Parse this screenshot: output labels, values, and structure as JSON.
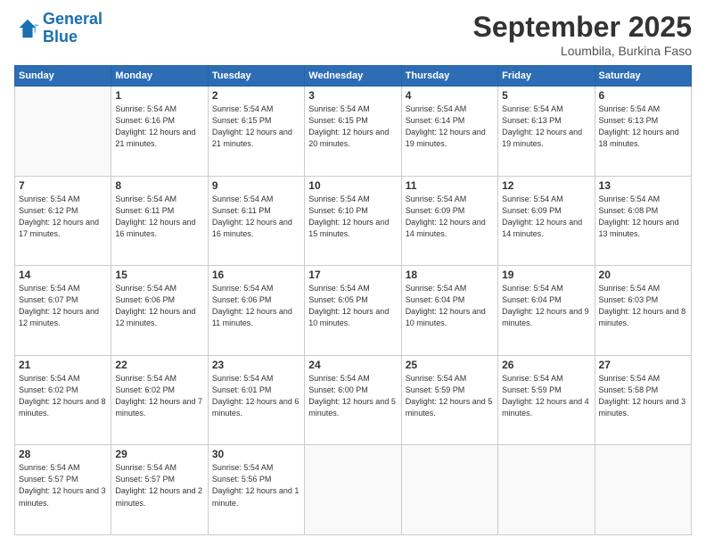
{
  "header": {
    "logo_line1": "General",
    "logo_line2": "Blue",
    "title": "September 2025",
    "location": "Loumbila, Burkina Faso"
  },
  "weekdays": [
    "Sunday",
    "Monday",
    "Tuesday",
    "Wednesday",
    "Thursday",
    "Friday",
    "Saturday"
  ],
  "weeks": [
    [
      {
        "day": "",
        "sunrise": "",
        "sunset": "",
        "daylight": ""
      },
      {
        "day": "1",
        "sunrise": "Sunrise: 5:54 AM",
        "sunset": "Sunset: 6:16 PM",
        "daylight": "Daylight: 12 hours and 21 minutes."
      },
      {
        "day": "2",
        "sunrise": "Sunrise: 5:54 AM",
        "sunset": "Sunset: 6:15 PM",
        "daylight": "Daylight: 12 hours and 21 minutes."
      },
      {
        "day": "3",
        "sunrise": "Sunrise: 5:54 AM",
        "sunset": "Sunset: 6:15 PM",
        "daylight": "Daylight: 12 hours and 20 minutes."
      },
      {
        "day": "4",
        "sunrise": "Sunrise: 5:54 AM",
        "sunset": "Sunset: 6:14 PM",
        "daylight": "Daylight: 12 hours and 19 minutes."
      },
      {
        "day": "5",
        "sunrise": "Sunrise: 5:54 AM",
        "sunset": "Sunset: 6:13 PM",
        "daylight": "Daylight: 12 hours and 19 minutes."
      },
      {
        "day": "6",
        "sunrise": "Sunrise: 5:54 AM",
        "sunset": "Sunset: 6:13 PM",
        "daylight": "Daylight: 12 hours and 18 minutes."
      }
    ],
    [
      {
        "day": "7",
        "sunrise": "Sunrise: 5:54 AM",
        "sunset": "Sunset: 6:12 PM",
        "daylight": "Daylight: 12 hours and 17 minutes."
      },
      {
        "day": "8",
        "sunrise": "Sunrise: 5:54 AM",
        "sunset": "Sunset: 6:11 PM",
        "daylight": "Daylight: 12 hours and 16 minutes."
      },
      {
        "day": "9",
        "sunrise": "Sunrise: 5:54 AM",
        "sunset": "Sunset: 6:11 PM",
        "daylight": "Daylight: 12 hours and 16 minutes."
      },
      {
        "day": "10",
        "sunrise": "Sunrise: 5:54 AM",
        "sunset": "Sunset: 6:10 PM",
        "daylight": "Daylight: 12 hours and 15 minutes."
      },
      {
        "day": "11",
        "sunrise": "Sunrise: 5:54 AM",
        "sunset": "Sunset: 6:09 PM",
        "daylight": "Daylight: 12 hours and 14 minutes."
      },
      {
        "day": "12",
        "sunrise": "Sunrise: 5:54 AM",
        "sunset": "Sunset: 6:09 PM",
        "daylight": "Daylight: 12 hours and 14 minutes."
      },
      {
        "day": "13",
        "sunrise": "Sunrise: 5:54 AM",
        "sunset": "Sunset: 6:08 PM",
        "daylight": "Daylight: 12 hours and 13 minutes."
      }
    ],
    [
      {
        "day": "14",
        "sunrise": "Sunrise: 5:54 AM",
        "sunset": "Sunset: 6:07 PM",
        "daylight": "Daylight: 12 hours and 12 minutes."
      },
      {
        "day": "15",
        "sunrise": "Sunrise: 5:54 AM",
        "sunset": "Sunset: 6:06 PM",
        "daylight": "Daylight: 12 hours and 12 minutes."
      },
      {
        "day": "16",
        "sunrise": "Sunrise: 5:54 AM",
        "sunset": "Sunset: 6:06 PM",
        "daylight": "Daylight: 12 hours and 11 minutes."
      },
      {
        "day": "17",
        "sunrise": "Sunrise: 5:54 AM",
        "sunset": "Sunset: 6:05 PM",
        "daylight": "Daylight: 12 hours and 10 minutes."
      },
      {
        "day": "18",
        "sunrise": "Sunrise: 5:54 AM",
        "sunset": "Sunset: 6:04 PM",
        "daylight": "Daylight: 12 hours and 10 minutes."
      },
      {
        "day": "19",
        "sunrise": "Sunrise: 5:54 AM",
        "sunset": "Sunset: 6:04 PM",
        "daylight": "Daylight: 12 hours and 9 minutes."
      },
      {
        "day": "20",
        "sunrise": "Sunrise: 5:54 AM",
        "sunset": "Sunset: 6:03 PM",
        "daylight": "Daylight: 12 hours and 8 minutes."
      }
    ],
    [
      {
        "day": "21",
        "sunrise": "Sunrise: 5:54 AM",
        "sunset": "Sunset: 6:02 PM",
        "daylight": "Daylight: 12 hours and 8 minutes."
      },
      {
        "day": "22",
        "sunrise": "Sunrise: 5:54 AM",
        "sunset": "Sunset: 6:02 PM",
        "daylight": "Daylight: 12 hours and 7 minutes."
      },
      {
        "day": "23",
        "sunrise": "Sunrise: 5:54 AM",
        "sunset": "Sunset: 6:01 PM",
        "daylight": "Daylight: 12 hours and 6 minutes."
      },
      {
        "day": "24",
        "sunrise": "Sunrise: 5:54 AM",
        "sunset": "Sunset: 6:00 PM",
        "daylight": "Daylight: 12 hours and 5 minutes."
      },
      {
        "day": "25",
        "sunrise": "Sunrise: 5:54 AM",
        "sunset": "Sunset: 5:59 PM",
        "daylight": "Daylight: 12 hours and 5 minutes."
      },
      {
        "day": "26",
        "sunrise": "Sunrise: 5:54 AM",
        "sunset": "Sunset: 5:59 PM",
        "daylight": "Daylight: 12 hours and 4 minutes."
      },
      {
        "day": "27",
        "sunrise": "Sunrise: 5:54 AM",
        "sunset": "Sunset: 5:58 PM",
        "daylight": "Daylight: 12 hours and 3 minutes."
      }
    ],
    [
      {
        "day": "28",
        "sunrise": "Sunrise: 5:54 AM",
        "sunset": "Sunset: 5:57 PM",
        "daylight": "Daylight: 12 hours and 3 minutes."
      },
      {
        "day": "29",
        "sunrise": "Sunrise: 5:54 AM",
        "sunset": "Sunset: 5:57 PM",
        "daylight": "Daylight: 12 hours and 2 minutes."
      },
      {
        "day": "30",
        "sunrise": "Sunrise: 5:54 AM",
        "sunset": "Sunset: 5:56 PM",
        "daylight": "Daylight: 12 hours and 1 minute."
      },
      {
        "day": "",
        "sunrise": "",
        "sunset": "",
        "daylight": ""
      },
      {
        "day": "",
        "sunrise": "",
        "sunset": "",
        "daylight": ""
      },
      {
        "day": "",
        "sunrise": "",
        "sunset": "",
        "daylight": ""
      },
      {
        "day": "",
        "sunrise": "",
        "sunset": "",
        "daylight": ""
      }
    ]
  ]
}
